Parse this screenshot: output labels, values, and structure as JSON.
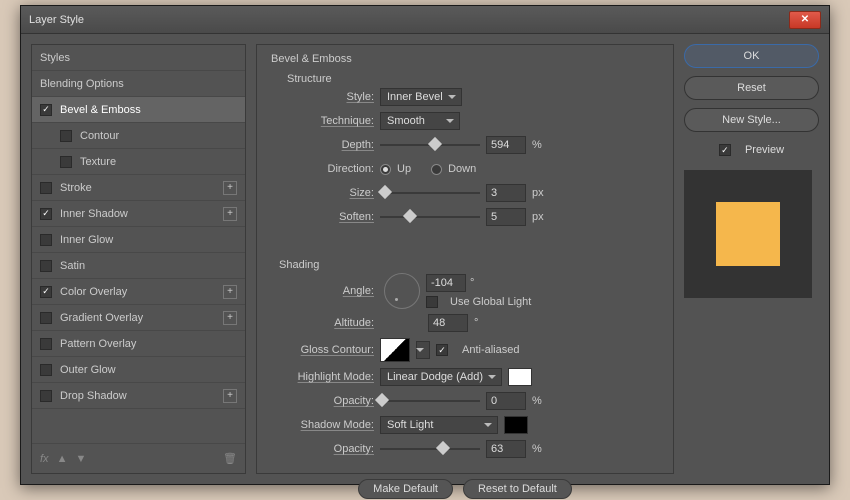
{
  "window": {
    "title": "Layer Style"
  },
  "sidebar": {
    "styles_label": "Styles",
    "blending_label": "Blending Options",
    "items": [
      {
        "label": "Bevel & Emboss",
        "checked": true
      },
      {
        "label": "Contour",
        "checked": false
      },
      {
        "label": "Texture",
        "checked": false
      },
      {
        "label": "Stroke",
        "checked": false
      },
      {
        "label": "Inner Shadow",
        "checked": true
      },
      {
        "label": "Inner Glow",
        "checked": false
      },
      {
        "label": "Satin",
        "checked": false
      },
      {
        "label": "Color Overlay",
        "checked": true
      },
      {
        "label": "Gradient Overlay",
        "checked": false
      },
      {
        "label": "Pattern Overlay",
        "checked": false
      },
      {
        "label": "Outer Glow",
        "checked": false
      },
      {
        "label": "Drop Shadow",
        "checked": false
      }
    ]
  },
  "bevel": {
    "group_title": "Bevel & Emboss",
    "structure_title": "Structure",
    "style_label": "Style:",
    "style_value": "Inner Bevel",
    "technique_label": "Technique:",
    "technique_value": "Smooth",
    "depth_label": "Depth:",
    "depth_value": "594",
    "depth_unit": "%",
    "direction_label": "Direction:",
    "up": "Up",
    "down": "Down",
    "size_label": "Size:",
    "size_value": "3",
    "size_unit": "px",
    "soften_label": "Soften:",
    "soften_value": "5",
    "soften_unit": "px"
  },
  "shading": {
    "title": "Shading",
    "angle_label": "Angle:",
    "angle_value": "-104",
    "angle_unit": "°",
    "global_label": "Use Global Light",
    "altitude_label": "Altitude:",
    "altitude_value": "48",
    "altitude_unit": "°",
    "gloss_label": "Gloss Contour:",
    "aa_label": "Anti-aliased",
    "highlight_label": "Highlight Mode:",
    "highlight_value": "Linear Dodge (Add)",
    "highlight_color": "#ffffff",
    "opacity_label": "Opacity:",
    "h_opacity_value": "0",
    "opacity_unit": "%",
    "shadow_label": "Shadow Mode:",
    "shadow_value": "Soft Light",
    "shadow_color": "#000000",
    "s_opacity_value": "63"
  },
  "buttons": {
    "make_default": "Make Default",
    "reset_default": "Reset to Default",
    "ok": "OK",
    "reset": "Reset",
    "new_style": "New Style...",
    "preview": "Preview"
  }
}
